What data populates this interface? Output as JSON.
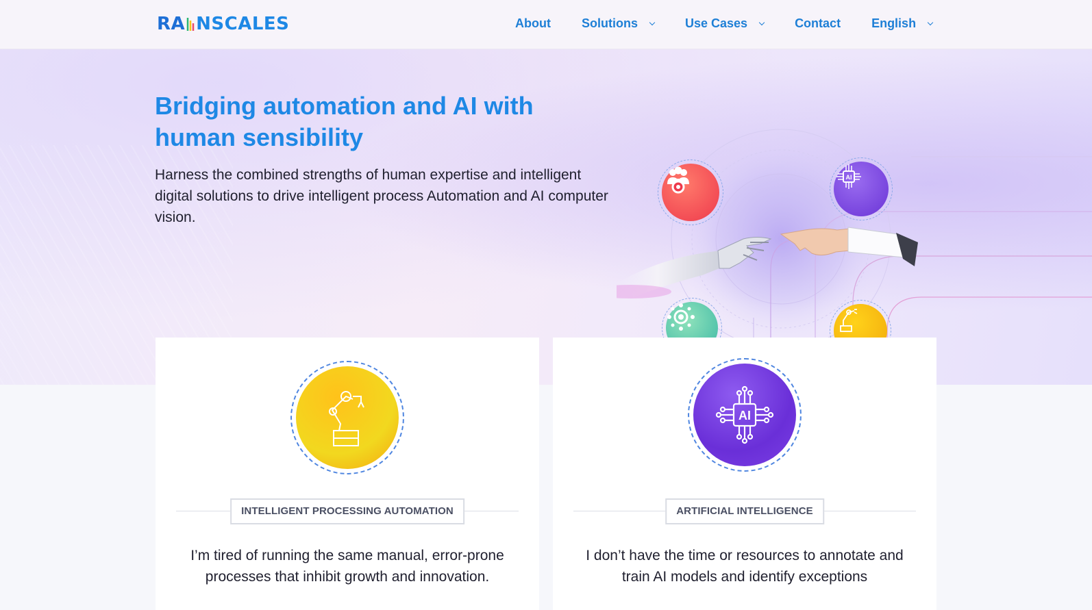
{
  "header": {
    "logo_text_a": "RA",
    "logo_text_b": "NSCALES",
    "nav": {
      "about": "About",
      "solutions": "Solutions",
      "use_cases": "Use Cases",
      "contact": "Contact",
      "language": "English"
    }
  },
  "hero": {
    "title": "Bridging automation and AI with human sensibility",
    "subtitle": "Harness the combined strengths of human expertise and intelligent digital solutions to drive intelligent process Automation and  AI computer vision.",
    "icons": [
      "people-gear-icon",
      "ai-chip-icon",
      "gear-network-icon",
      "robot-arm-icon"
    ]
  },
  "cards": [
    {
      "icon": "robot-arm-icon",
      "label": "INTELLIGENT PROCESSING AUTOMATION",
      "text": "I’m tired of running the same manual, error-prone processes that inhibit growth and innovation."
    },
    {
      "icon": "ai-chip-icon",
      "icon_text": "AI",
      "label": "ARTIFICIAL INTELLIGENCE",
      "text": "I don’t have the time or resources to annotate and train AI models and identify exceptions"
    }
  ],
  "colors": {
    "brand_blue": "#1e88e5",
    "orange_red": "#f2454f",
    "purple": "#7a3fe0",
    "teal": "#4cc6a6",
    "yellow": "#f5c518"
  }
}
